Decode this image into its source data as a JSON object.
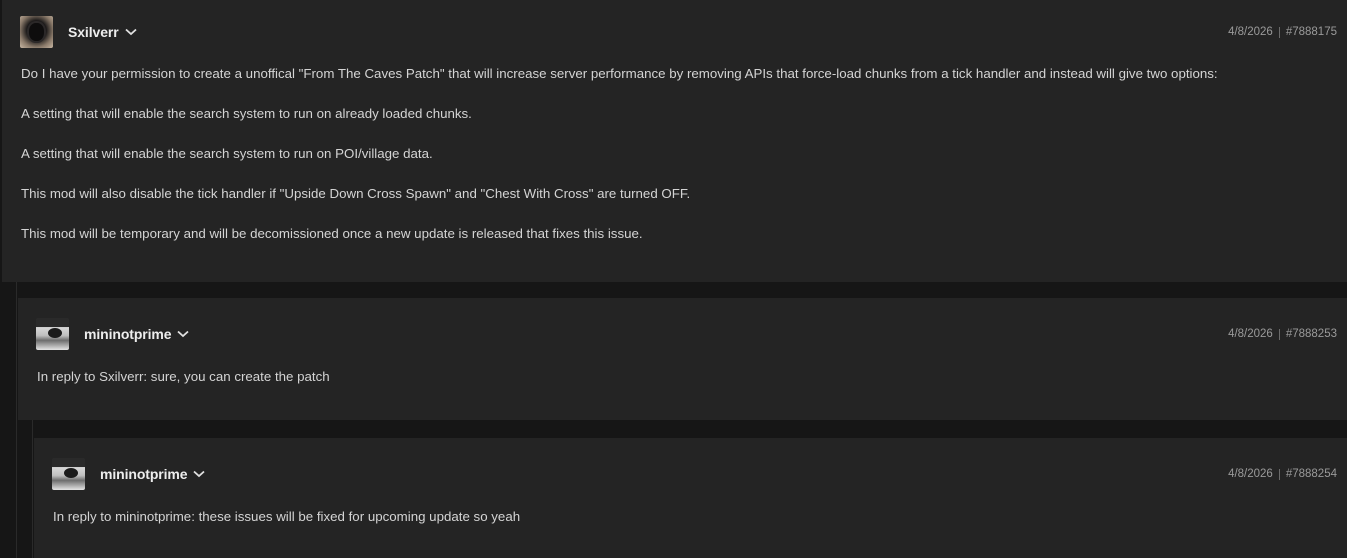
{
  "comments": [
    {
      "user": "Sxilverr",
      "date": "4/8/2026",
      "id": "#7888175",
      "avatar_icon": "skull-avatar",
      "paragraphs": [
        "Do I have your permission to create a unoffical \"From The Caves Patch\" that will increase server performance by removing APIs that force-load chunks from a tick handler and instead will give two options:",
        "A setting that will enable the search system to run on already loaded chunks.",
        "A setting that will enable the search system to run on POI/village data.",
        "This mod will also disable the tick handler if \"Upside Down Cross Spawn\" and \"Chest With Cross\" are turned OFF.",
        "This mod will be temporary and will be decomissioned once a new update is released that fixes this issue."
      ]
    },
    {
      "user": "mininotprime",
      "date": "4/8/2026",
      "id": "#7888253",
      "avatar_icon": "photo-avatar",
      "paragraphs": [
        "In reply to Sxilverr: sure, you can create the patch"
      ]
    },
    {
      "user": "mininotprime",
      "date": "4/8/2026",
      "id": "#7888254",
      "avatar_icon": "photo-avatar",
      "paragraphs": [
        "In reply to mininotprime: these issues will be fixed for upcoming update so yeah"
      ]
    }
  ],
  "colors": {
    "page_bg": "#161616",
    "card_bg": "#242424",
    "text": "#d4d4d4",
    "username": "#ededed",
    "meta": "#9a9a9a"
  }
}
